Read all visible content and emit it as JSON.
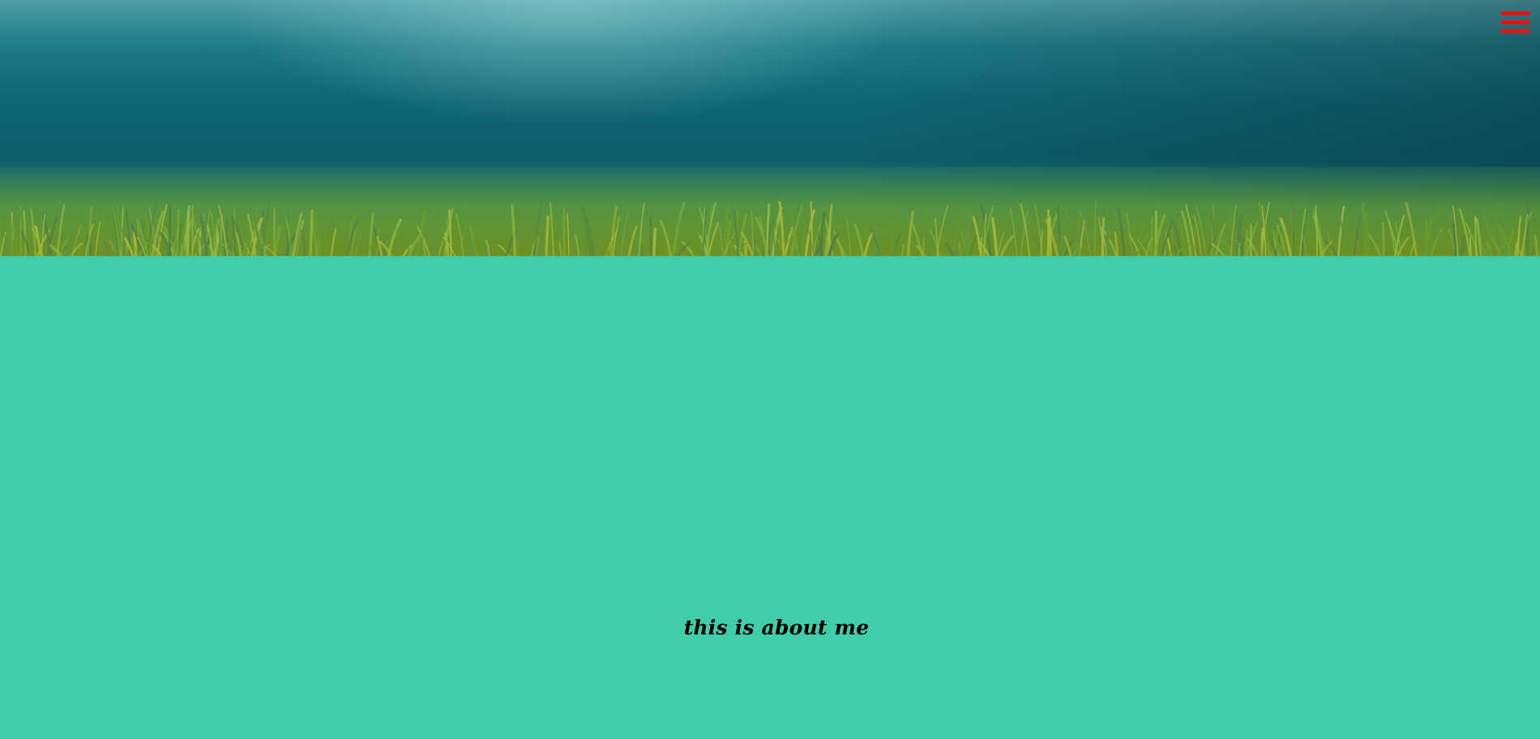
{
  "header": {
    "menu_icon": "hamburger-menu-icon",
    "menu_icon_color": "#e01515",
    "hero_image": "underwater-seagrass-banner"
  },
  "about": {
    "text": "this is about me",
    "background_color": "#41cdaa"
  }
}
